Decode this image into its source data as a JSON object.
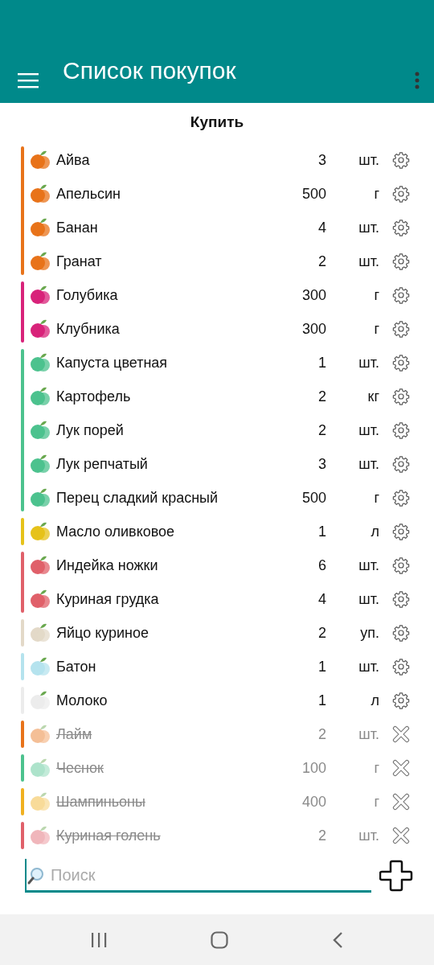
{
  "app_bar": {
    "title": "Список покупок"
  },
  "section_title": "Купить",
  "groups": [
    {
      "color": "#e8731a",
      "items": [
        {
          "name": "Айва",
          "qty": "3",
          "unit": "шт.",
          "done": false
        },
        {
          "name": "Апельсин",
          "qty": "500",
          "unit": "г",
          "done": false
        },
        {
          "name": "Банан",
          "qty": "4",
          "unit": "шт.",
          "done": false
        },
        {
          "name": "Гранат",
          "qty": "2",
          "unit": "шт.",
          "done": false
        }
      ]
    },
    {
      "color": "#d8237a",
      "items": [
        {
          "name": "Голубика",
          "qty": "300",
          "unit": "г",
          "done": false
        },
        {
          "name": "Клубника",
          "qty": "300",
          "unit": "г",
          "done": false
        }
      ]
    },
    {
      "color": "#4cc28e",
      "items": [
        {
          "name": "Капуста цветная",
          "qty": "1",
          "unit": "шт.",
          "done": false
        },
        {
          "name": "Картофель",
          "qty": "2",
          "unit": "кг",
          "done": false
        },
        {
          "name": "Лук порей",
          "qty": "2",
          "unit": "шт.",
          "done": false
        },
        {
          "name": "Лук репчатый",
          "qty": "3",
          "unit": "шт.",
          "done": false
        },
        {
          "name": "Перец сладкий красный",
          "qty": "500",
          "unit": "г",
          "done": false
        }
      ]
    },
    {
      "color": "#e6c21a",
      "items": [
        {
          "name": "Масло оливковое",
          "qty": "1",
          "unit": "л",
          "done": false
        }
      ]
    },
    {
      "color": "#e0606a",
      "items": [
        {
          "name": "Индейка ножки",
          "qty": "6",
          "unit": "шт.",
          "done": false
        },
        {
          "name": "Куриная грудка",
          "qty": "4",
          "unit": "шт.",
          "done": false
        }
      ]
    },
    {
      "color": "#e3d9c8",
      "items": [
        {
          "name": "Яйцо куриное",
          "qty": "2",
          "unit": "уп.",
          "done": false
        }
      ]
    },
    {
      "color": "#b5e3ee",
      "items": [
        {
          "name": "Батон",
          "qty": "1",
          "unit": "шт.",
          "done": false
        }
      ]
    },
    {
      "color": "#ececec",
      "items": [
        {
          "name": "Молоко",
          "qty": "1",
          "unit": "л",
          "done": false
        }
      ]
    },
    {
      "color": "#e8731a",
      "items": [
        {
          "name": "Лайм",
          "qty": "2",
          "unit": "шт.",
          "done": true
        }
      ]
    },
    {
      "color": "#4cc28e",
      "items": [
        {
          "name": "Чеснок",
          "qty": "100",
          "unit": "г",
          "done": true
        }
      ]
    },
    {
      "color": "#f0b020",
      "items": [
        {
          "name": "Шампиньоны",
          "qty": "400",
          "unit": "г",
          "done": true
        }
      ]
    },
    {
      "color": "#e0606a",
      "items": [
        {
          "name": "Куриная голень",
          "qty": "2",
          "unit": "шт.",
          "done": true
        }
      ]
    }
  ],
  "search": {
    "placeholder": "Поиск"
  }
}
